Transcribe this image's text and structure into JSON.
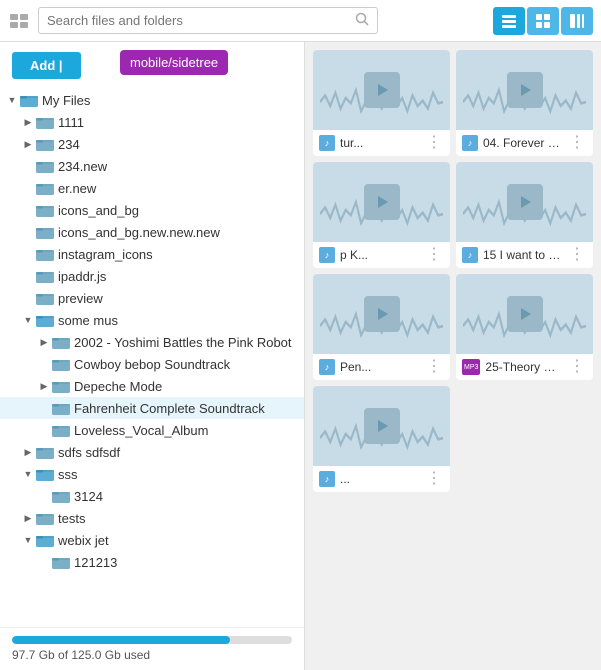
{
  "toolbar": {
    "search_placeholder": "Search files and folders",
    "views": [
      {
        "id": "list",
        "active": true,
        "label": "list-view"
      },
      {
        "id": "grid",
        "active": false,
        "label": "grid-view"
      },
      {
        "id": "panel",
        "active": false,
        "label": "panel-view"
      }
    ]
  },
  "sidebar": {
    "add_button_label": "Add |",
    "tooltip": "mobile/sidetree",
    "tree": [
      {
        "id": "myfiles",
        "level": 0,
        "label": "My Files",
        "expanded": true,
        "toggle": "▼",
        "type": "folder"
      },
      {
        "id": "1111",
        "level": 1,
        "label": "1111",
        "expanded": false,
        "toggle": "▶",
        "type": "folder"
      },
      {
        "id": "234",
        "level": 1,
        "label": "234",
        "expanded": false,
        "toggle": "▶",
        "type": "folder"
      },
      {
        "id": "234new",
        "level": 1,
        "label": "234.new",
        "expanded": false,
        "toggle": "empty",
        "type": "folder"
      },
      {
        "id": "ernew",
        "level": 1,
        "label": "er.new",
        "expanded": false,
        "toggle": "empty",
        "type": "folder"
      },
      {
        "id": "icons_bg",
        "level": 1,
        "label": "icons_and_bg",
        "expanded": false,
        "toggle": "empty",
        "type": "folder"
      },
      {
        "id": "icons_bg_new",
        "level": 1,
        "label": "icons_and_bg.new.new.new",
        "expanded": false,
        "toggle": "empty",
        "type": "folder"
      },
      {
        "id": "instagram",
        "level": 1,
        "label": "instagram_icons",
        "expanded": false,
        "toggle": "empty",
        "type": "folder"
      },
      {
        "id": "ipaddr",
        "level": 1,
        "label": "ipaddr.js",
        "expanded": false,
        "toggle": "empty",
        "type": "folder"
      },
      {
        "id": "preview",
        "level": 1,
        "label": "preview",
        "expanded": false,
        "toggle": "empty",
        "type": "folder"
      },
      {
        "id": "someMus",
        "level": 1,
        "label": "some mus",
        "expanded": true,
        "toggle": "▼",
        "type": "folder"
      },
      {
        "id": "yoshimi",
        "level": 2,
        "label": "2002 - Yoshimi Battles the Pink Robot",
        "expanded": false,
        "toggle": "▶",
        "type": "folder"
      },
      {
        "id": "cowboy",
        "level": 2,
        "label": "Cowboy bebop Soundtrack",
        "expanded": false,
        "toggle": "empty",
        "type": "folder"
      },
      {
        "id": "depeche",
        "level": 2,
        "label": "Depeche Mode",
        "expanded": false,
        "toggle": "▶",
        "type": "folder"
      },
      {
        "id": "fahrenheit",
        "level": 2,
        "label": "Fahrenheit Complete Soundtrack",
        "expanded": false,
        "toggle": "empty",
        "type": "folder",
        "selected": true
      },
      {
        "id": "loveless",
        "level": 2,
        "label": "Loveless_Vocal_Album",
        "expanded": false,
        "toggle": "empty",
        "type": "folder"
      },
      {
        "id": "sdfs",
        "level": 1,
        "label": "sdfs sdfsdf",
        "expanded": false,
        "toggle": "▶",
        "type": "folder"
      },
      {
        "id": "sss",
        "level": 1,
        "label": "sss",
        "expanded": true,
        "toggle": "▼",
        "type": "folder"
      },
      {
        "id": "3124",
        "level": 2,
        "label": "3124",
        "expanded": false,
        "toggle": "empty",
        "type": "folder"
      },
      {
        "id": "tests",
        "level": 1,
        "label": "tests",
        "expanded": false,
        "toggle": "▶",
        "type": "folder"
      },
      {
        "id": "webix",
        "level": 1,
        "label": "webix jet",
        "expanded": true,
        "toggle": "▼",
        "type": "folder"
      },
      {
        "id": "121213",
        "level": 2,
        "label": "121213",
        "expanded": false,
        "toggle": "empty",
        "type": "folder"
      }
    ],
    "storage": {
      "used": "97.7 Gb of 125.0 Gb used",
      "percent": 78
    }
  },
  "files": [
    {
      "id": "f1",
      "name": "tur...",
      "badge_type": "blue",
      "badge_text": "♪",
      "more": "⋮"
    },
    {
      "id": "f2",
      "name": "04. Forever Bl...",
      "badge_type": "blue",
      "badge_text": "♪",
      "more": "⋮"
    },
    {
      "id": "f3",
      "name": "p K...",
      "badge_type": "blue",
      "badge_text": "♪",
      "more": "⋮"
    },
    {
      "id": "f4",
      "name": "15 I want to kn...",
      "badge_type": "blue",
      "badge_text": "♪",
      "more": "⋮"
    },
    {
      "id": "f5",
      "name": "Pen...",
      "badge_type": "blue",
      "badge_text": "♪",
      "more": "⋮"
    },
    {
      "id": "f6",
      "name": "25-Theory Of ...",
      "badge_type": "purple",
      "badge_text": "MP3",
      "more": "⋮"
    },
    {
      "id": "f7",
      "name": "...",
      "badge_type": "blue",
      "badge_text": "♪",
      "more": "⋮"
    }
  ],
  "colors": {
    "teal": "#1ca8dd",
    "purple": "#9c27b0",
    "folder_dark": "#7b9ab0",
    "folder_light": "#9ab8c8",
    "audio_bg": "#c8dce8"
  }
}
